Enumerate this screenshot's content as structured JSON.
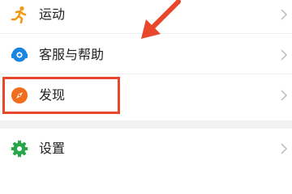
{
  "menu": {
    "items": [
      {
        "label": "运动",
        "icon": "running-person-icon",
        "color": "#f19a1a"
      },
      {
        "label": "客服与帮助",
        "icon": "customer-service-icon",
        "color": "#1a86e0"
      },
      {
        "label": "发现",
        "icon": "compass-icon",
        "color": "#f06d1d"
      },
      {
        "label": "设置",
        "icon": "gear-icon",
        "color": "#27a64a"
      }
    ]
  },
  "annotation": {
    "color": "#e8472b"
  }
}
